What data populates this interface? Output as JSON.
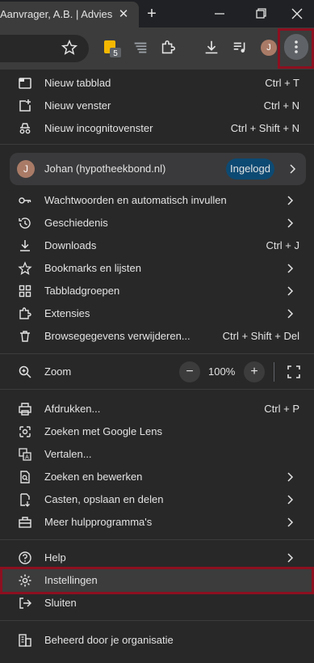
{
  "tab": {
    "title": "Aanvrager, A.B. | Advies",
    "close_icon": "close-icon",
    "new_tab_icon": "plus-icon"
  },
  "window_controls": {
    "minimize_icon": "minimize-icon",
    "restore_icon": "restore-icon",
    "close_icon": "close-icon"
  },
  "toolbar": {
    "icons": [
      "star-icon",
      "extension-5-icon",
      "reading-list-icon",
      "puzzle-icon",
      "download-icon",
      "media-icon"
    ],
    "extension_badge": "5",
    "profile_initial": "J",
    "menu_icon": "kebab-icon"
  },
  "menu": {
    "group1": [
      {
        "label": "Nieuw tabblad",
        "shortcut": "Ctrl + T"
      },
      {
        "label": "Nieuw venster",
        "shortcut": "Ctrl + N"
      },
      {
        "label": "Nieuw incognitovenster",
        "shortcut": "Ctrl + Shift + N"
      }
    ],
    "profile": {
      "initial": "J",
      "name": "Johan (hypotheekbond.nl)",
      "badge": "Ingelogd"
    },
    "group2": [
      {
        "label": "Wachtwoorden en automatisch invullen",
        "shortcut": ""
      },
      {
        "label": "Geschiedenis",
        "shortcut": ""
      },
      {
        "label": "Downloads",
        "shortcut": "Ctrl + J"
      },
      {
        "label": "Bookmarks en lijsten",
        "shortcut": ""
      },
      {
        "label": "Tabbladgroepen",
        "shortcut": ""
      },
      {
        "label": "Extensies",
        "shortcut": ""
      },
      {
        "label": "Browsegegevens verwijderen...",
        "shortcut": "Ctrl + Shift + Del"
      }
    ],
    "zoom": {
      "label": "Zoom",
      "minus": "−",
      "value": "100%",
      "plus": "+"
    },
    "group3": [
      {
        "label": "Afdrukken...",
        "shortcut": "Ctrl + P"
      },
      {
        "label": "Zoeken met Google Lens",
        "shortcut": ""
      },
      {
        "label": "Vertalen...",
        "shortcut": ""
      },
      {
        "label": "Zoeken en bewerken",
        "shortcut": ""
      },
      {
        "label": "Casten, opslaan en delen",
        "shortcut": ""
      },
      {
        "label": "Meer hulpprogramma's",
        "shortcut": ""
      }
    ],
    "group4": [
      {
        "label": "Help",
        "shortcut": ""
      },
      {
        "label": "Instellingen",
        "shortcut": ""
      },
      {
        "label": "Sluiten",
        "shortcut": ""
      }
    ],
    "managed": {
      "label": "Beheerd door je organisatie"
    }
  },
  "colors": {
    "highlight": "#8c1020",
    "badge_bg": "#0d4a73",
    "menu_bg": "#282828"
  }
}
